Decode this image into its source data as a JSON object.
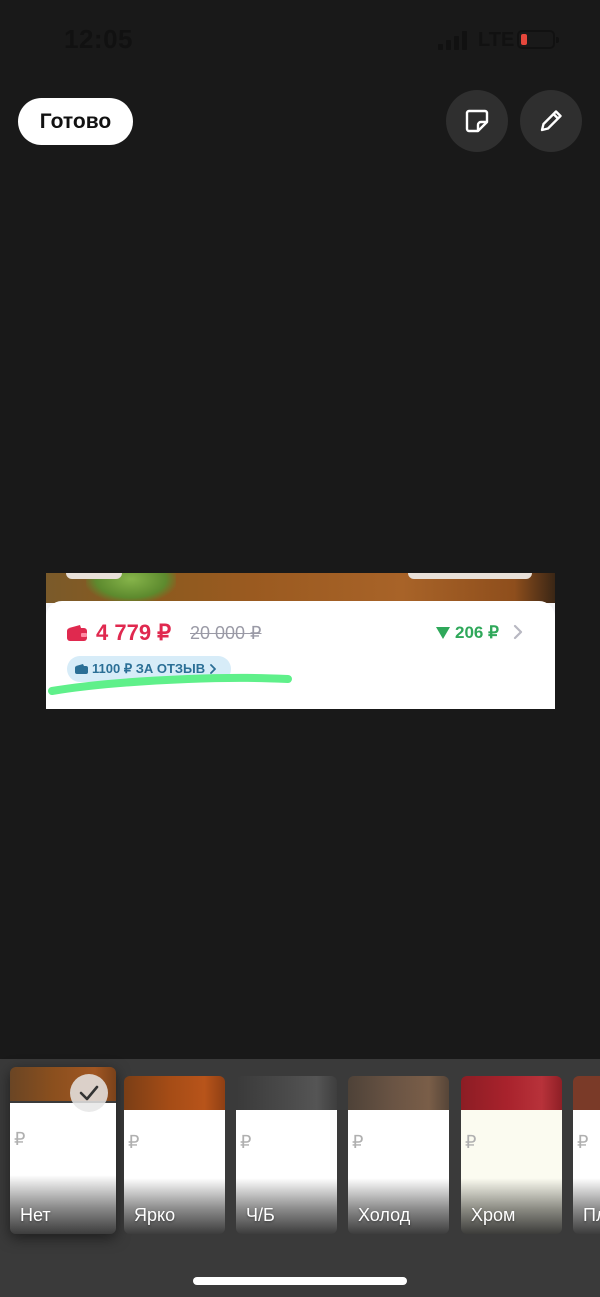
{
  "status_bar": {
    "time": "12:05",
    "network": "LTE"
  },
  "toolbar": {
    "done_label": "Готово",
    "sticker_icon": "sticker-icon",
    "edit_icon": "pencil-icon"
  },
  "photo": {
    "price": "4 779 ₽",
    "old_price": "20 000 ₽",
    "price_drop": "206 ₽",
    "review_bonus": "1100 ₽ ЗА ОТЗЫВ",
    "price_color": "#e0294f",
    "drop_color": "#2fa85a",
    "highlight_color": "#5ff08a"
  },
  "filters": {
    "selected": "Нет",
    "ruble_mark": "₽",
    "items": [
      {
        "label": "Нет"
      },
      {
        "label": "Ярко"
      },
      {
        "label": "Ч/Б"
      },
      {
        "label": "Холод"
      },
      {
        "label": "Хром"
      },
      {
        "label": "Пл"
      }
    ]
  }
}
